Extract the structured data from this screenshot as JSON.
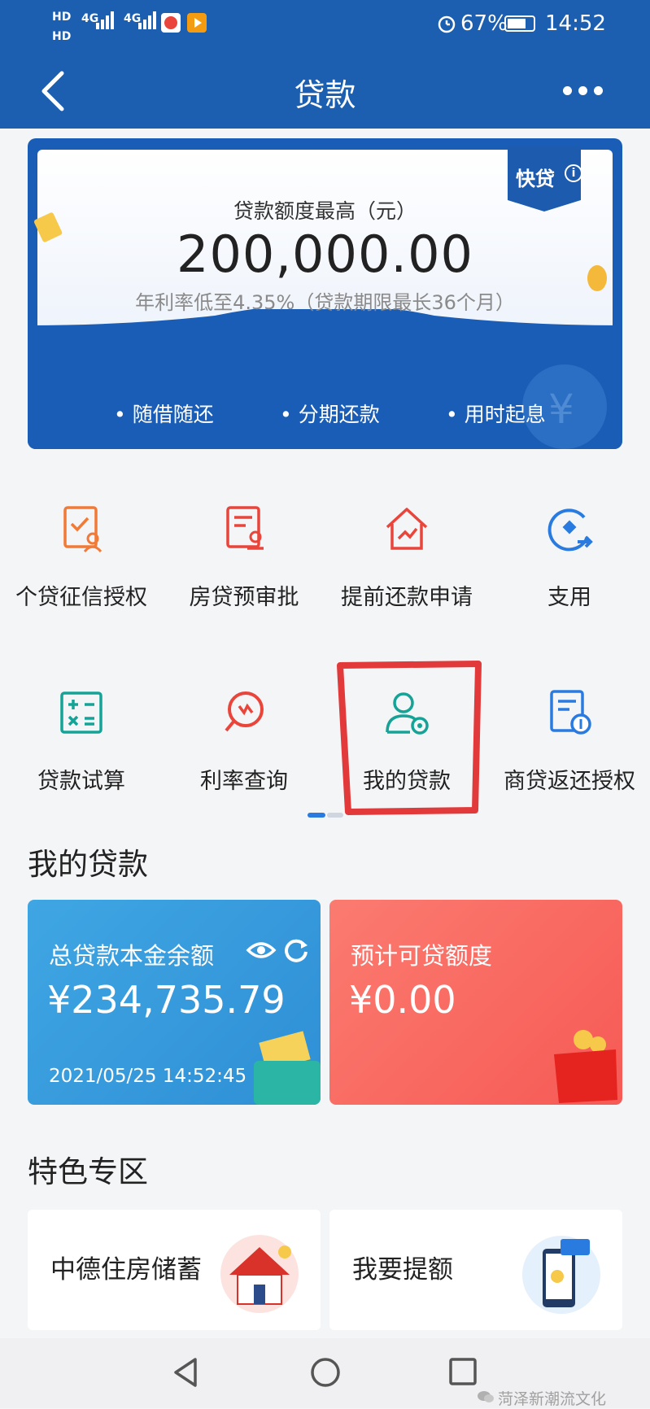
{
  "status_bar": {
    "hd1": "HD",
    "hd2": "HD",
    "net1": "4G",
    "net2": "4G",
    "battery": "67%",
    "time": "14:52"
  },
  "header": {
    "title": "贷款"
  },
  "banner": {
    "tag": "快贷",
    "quota_label": "贷款额度最高（元）",
    "quota_amount": "200,000.00",
    "quota_note": "年利率低至4.35%（贷款期限最长36个月）",
    "features": [
      "• 随借随还",
      "• 分期还款",
      "• 用时起息"
    ]
  },
  "services": [
    {
      "label": "个贷征信授权",
      "icon": "credit-authorization-icon"
    },
    {
      "label": "房贷预审批",
      "icon": "mortgage-preapproval-icon"
    },
    {
      "label": "提前还款申请",
      "icon": "early-repayment-icon"
    },
    {
      "label": "支用",
      "icon": "drawdown-icon"
    },
    {
      "label": "贷款试算",
      "icon": "loan-calculator-icon"
    },
    {
      "label": "利率查询",
      "icon": "rate-inquiry-icon"
    },
    {
      "label": "我的贷款",
      "icon": "my-loans-icon"
    },
    {
      "label": "商贷返还授权",
      "icon": "commercial-loan-refund-icon"
    }
  ],
  "my_loans": {
    "section_title": "我的贷款",
    "principal_label": "总贷款本金余额",
    "principal_amount": "¥234,735.79",
    "updated_time": "2021/05/25 14:52:45",
    "estimated_label": "预计可贷额度",
    "estimated_amount": "¥0.00"
  },
  "featured": {
    "section_title": "特色专区",
    "items": [
      "中德住房储蓄",
      "我要提额"
    ]
  },
  "watermark": "菏泽新潮流文化",
  "colors": {
    "brand_blue": "#1c5fb0",
    "icon_orange": "#f07a36",
    "icon_red": "#e9453b",
    "icon_teal": "#14a396",
    "icon_blue": "#2a7be0",
    "card_blue": "#3fa6e3",
    "card_red": "#f65a55",
    "highlight": "#e23a3a"
  }
}
